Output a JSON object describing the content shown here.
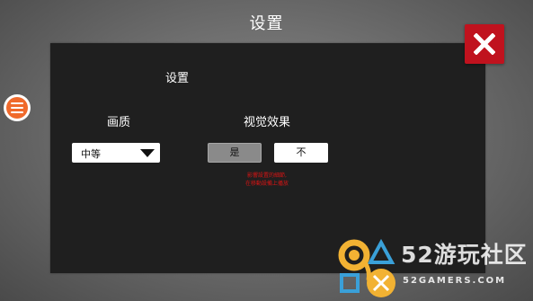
{
  "header": {
    "title": "设置"
  },
  "panel": {
    "title": "设置",
    "quality": {
      "label": "画质",
      "selected": "中等"
    },
    "visual_effects": {
      "label": "视觉效果",
      "yes_label": "是",
      "no_label": "不",
      "selected": "是"
    },
    "warning_lines": [
      "影響設置的細節,",
      "在移動設備上播放"
    ]
  },
  "watermark": {
    "brand": "52游玩社区",
    "site": "52GAMERS.COM"
  },
  "colors": {
    "close_button": "#c0121e",
    "menu_button": "#f06a2c",
    "warning_text": "#d91414",
    "panel_bg": "#1f1f1f"
  },
  "icons": {
    "close": "close-icon",
    "menu": "menu-icon",
    "dropdown": "chevron-down-icon"
  }
}
